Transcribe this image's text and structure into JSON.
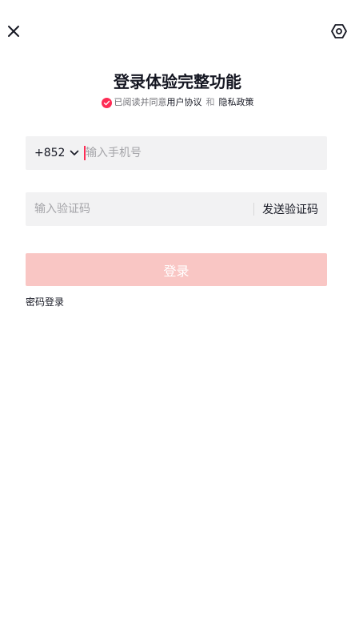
{
  "header": {
    "close_icon": "close-icon",
    "settings_icon": "hexagon-settings-icon"
  },
  "title": "登录体验完整功能",
  "agreement": {
    "check_icon": "check-circle-icon",
    "prefix": "已阅读并同意",
    "user_agreement": "用户协议",
    "and": "和",
    "privacy_policy": "隐私政策"
  },
  "phone": {
    "country_code": "+852",
    "placeholder": "输入手机号",
    "value": ""
  },
  "code": {
    "placeholder": "输入验证码",
    "value": "",
    "send_label": "发送验证码"
  },
  "login_button": {
    "label": "登录",
    "enabled": false
  },
  "password_login": "密码登录",
  "colors": {
    "accent": "#fe2c55",
    "login_disabled": "#f9c6c4",
    "input_bg": "#f2f2f3",
    "text": "#161823",
    "placeholder": "#a4a4a8"
  }
}
